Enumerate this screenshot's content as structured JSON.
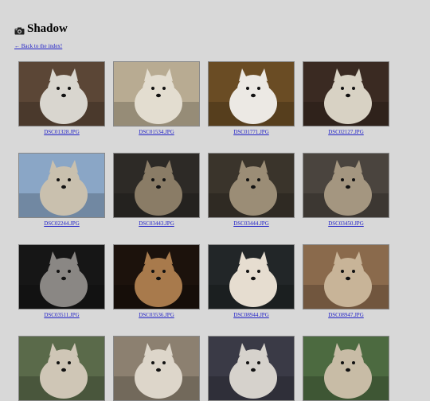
{
  "page": {
    "title": "Shadow",
    "back_link": "← Back to the index!"
  },
  "photos": [
    {
      "caption": "DSC01328.JPG",
      "bg": "#5b4636",
      "dog": "#d9d6cf"
    },
    {
      "caption": "DSC01534.JPG",
      "bg": "#b8ab92",
      "dog": "#e3ddd0"
    },
    {
      "caption": "DSC01771.JPG",
      "bg": "#6a4c24",
      "dog": "#ece9e4"
    },
    {
      "caption": "DSC02127.JPG",
      "bg": "#3a2a22",
      "dog": "#d8d2c4"
    },
    {
      "caption": "DSC02244.JPG",
      "bg": "#8aa6c6",
      "dog": "#c9c0ae"
    },
    {
      "caption": "DSC03443.JPG",
      "bg": "#2d2a26",
      "dog": "#8a7c66"
    },
    {
      "caption": "DSC03444.JPG",
      "bg": "#3a342b",
      "dog": "#9b8d76"
    },
    {
      "caption": "DSC03450.JPG",
      "bg": "#4a443e",
      "dog": "#a49680"
    },
    {
      "caption": "DSC03511.JPG",
      "bg": "#161616",
      "dog": "#8a8784"
    },
    {
      "caption": "DSC03536.JPG",
      "bg": "#1c120c",
      "dog": "#a87a4c"
    },
    {
      "caption": "DSC08944.JPG",
      "bg": "#222628",
      "dog": "#e6ddd0"
    },
    {
      "caption": "DSC08947.JPG",
      "bg": "#8a6a4c",
      "dog": "#c8b498"
    },
    {
      "caption": "",
      "bg": "#5a6a4a",
      "dog": "#cfc6b6"
    },
    {
      "caption": "",
      "bg": "#8c8070",
      "dog": "#ddd6ca"
    },
    {
      "caption": "",
      "bg": "#3a3a46",
      "dog": "#d6d2cc"
    },
    {
      "caption": "",
      "bg": "#4c6a40",
      "dog": "#c8bca6"
    }
  ]
}
